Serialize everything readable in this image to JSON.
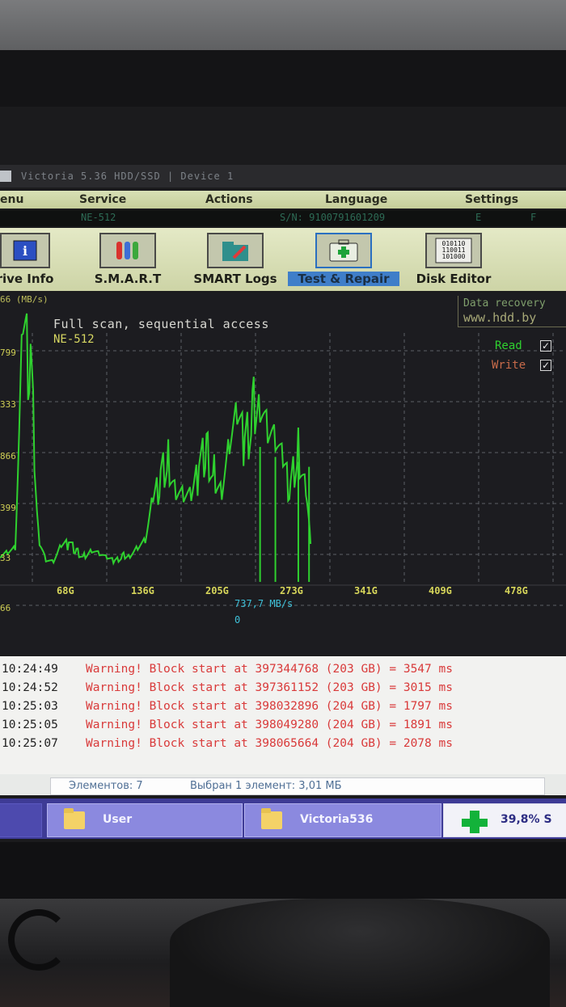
{
  "window": {
    "title": "Victoria 5.36 HDD/SSD | Device 1"
  },
  "menu": {
    "items": [
      "enu",
      "Service",
      "Actions",
      "Language",
      "Settings"
    ]
  },
  "infobar": {
    "model": "NE-512",
    "serial": "S/N: 9100791601209",
    "extra1": "E",
    "extra2": "F"
  },
  "toolbar": {
    "buttons": [
      {
        "label": "rive Info",
        "icon": "info-icon"
      },
      {
        "label": "S.M.A.R.T",
        "icon": "smart-tubes-icon"
      },
      {
        "label": "SMART Logs",
        "icon": "folder-pen-icon"
      },
      {
        "label": "Test & Repair",
        "icon": "first-aid-kit-icon",
        "active": true
      },
      {
        "label": "Disk Editor",
        "icon": "binary-disk-icon"
      }
    ]
  },
  "graph": {
    "unit_label": "66 (MB/s)",
    "title": "Full scan, sequential access",
    "subtitle": "NE-512",
    "recovery_line1": "Data recovery",
    "recovery_line2": "www.hdd.by",
    "legend_read": "Read",
    "legend_write": "Write",
    "read_checked": "✓",
    "write_checked": "✓",
    "speed_label": "737,7 MB/s",
    "speed_value": "0",
    "colors": {
      "read": "#2fd12f",
      "write": "#c86b4a",
      "grid": "#5b5f66",
      "axis": "#d6d55a"
    }
  },
  "chart_data": {
    "type": "line",
    "title": "Full scan, sequential access",
    "xlabel": "",
    "ylabel": "",
    "x_ticks": [
      "68G",
      "136G",
      "205G",
      "273G",
      "341G",
      "409G",
      "478G"
    ],
    "y_ticks": [
      "799",
      "333",
      "866",
      "399",
      "33",
      "66"
    ],
    "series": [
      {
        "name": "Read",
        "x": [
          0,
          5,
          10,
          15,
          20,
          25,
          30,
          35,
          40,
          45,
          50,
          55,
          60,
          65,
          70,
          75,
          80,
          85,
          90,
          95,
          100,
          105,
          110,
          115,
          120,
          125,
          130,
          135,
          140,
          145,
          150,
          155,
          160,
          165,
          170,
          175,
          180,
          185,
          190,
          195,
          200,
          203
        ],
        "y": [
          40,
          45,
          50,
          470,
          420,
          80,
          30,
          25,
          55,
          60,
          45,
          35,
          50,
          40,
          30,
          25,
          35,
          40,
          55,
          65,
          140,
          190,
          230,
          180,
          160,
          150,
          205,
          250,
          200,
          175,
          260,
          300,
          255,
          320,
          380,
          300,
          260,
          210,
          170,
          250,
          190,
          60
        ]
      }
    ]
  },
  "log": {
    "rows": [
      {
        "time": "10:24:49",
        "message": "Warning! Block start at 397344768 (203 GB)  = 3547 ms"
      },
      {
        "time": "10:24:52",
        "message": "Warning! Block start at 397361152 (203 GB)  = 3015 ms"
      },
      {
        "time": "10:25:03",
        "message": "Warning! Block start at 398032896 (204 GB)  = 1797 ms"
      },
      {
        "time": "10:25:05",
        "message": "Warning! Block start at 398049280 (204 GB)  = 1891 ms"
      },
      {
        "time": "10:25:07",
        "message": "Warning! Block start at 398065664 (204 GB)  = 2078 ms"
      }
    ]
  },
  "status": {
    "elements": "Элементов: 7",
    "selected": "Выбран 1 элемент: 3,01 МБ"
  },
  "taskbar": {
    "items": [
      {
        "label": "User",
        "icon": "folder-icon"
      },
      {
        "label": "Victoria536",
        "icon": "folder-icon"
      },
      {
        "label": "39,8%  S",
        "icon": "green-plus-icon"
      }
    ]
  }
}
